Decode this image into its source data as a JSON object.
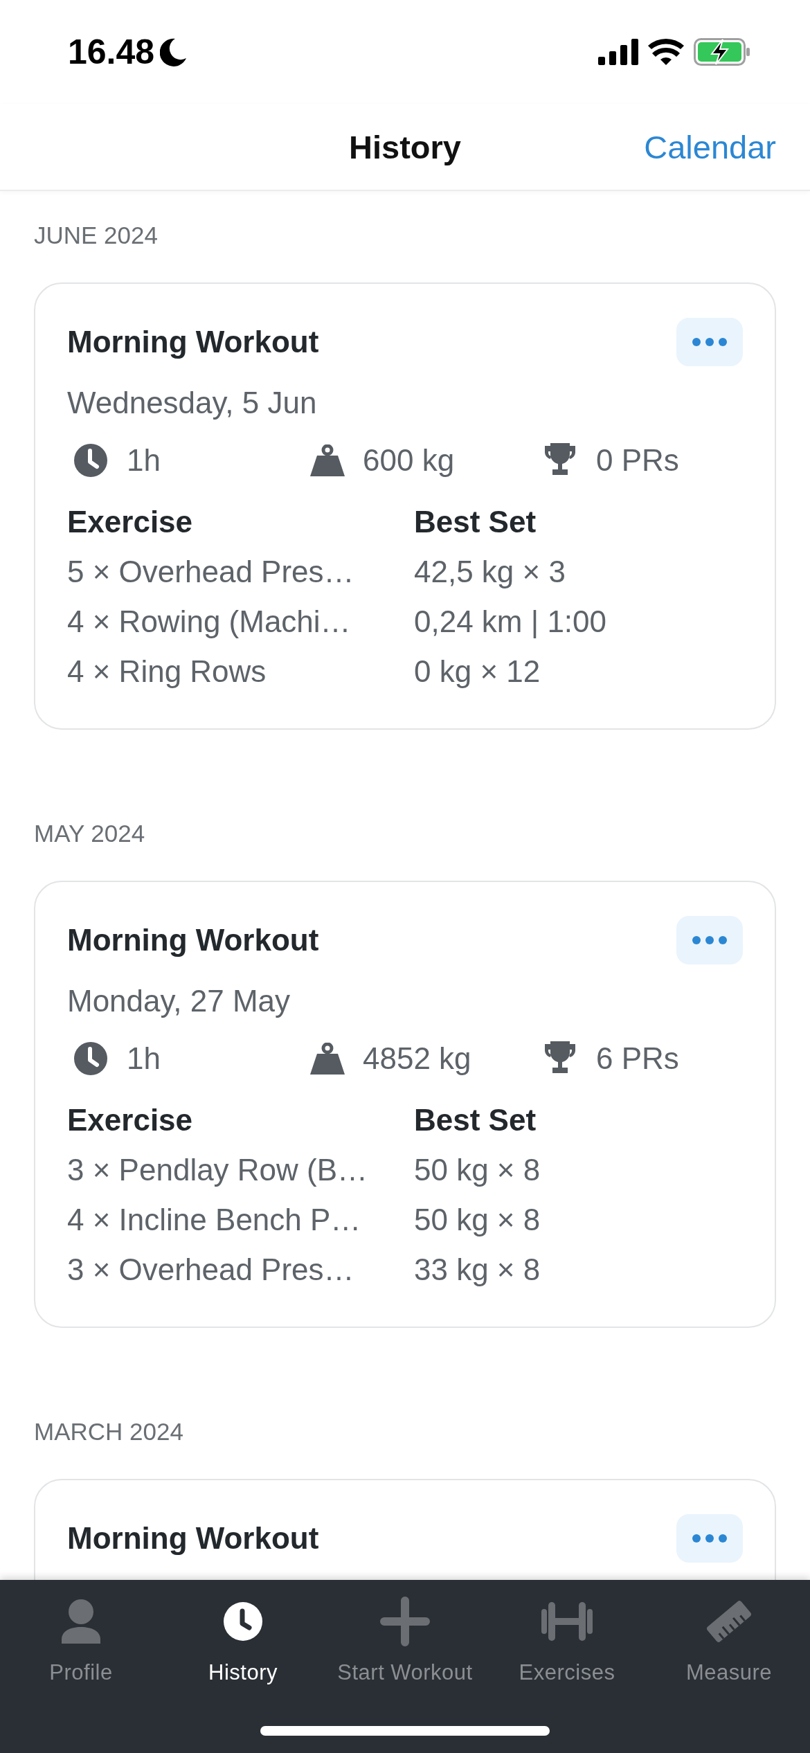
{
  "status_bar": {
    "time": "16.48"
  },
  "header": {
    "title": "History",
    "action": "Calendar"
  },
  "sections": [
    {
      "label": "JUNE 2024",
      "workouts": [
        {
          "title": "Morning Workout",
          "date": "Wednesday, 5 Jun",
          "stats": [
            {
              "kind": "duration",
              "text": "1h"
            },
            {
              "kind": "volume",
              "text": "600 kg"
            },
            {
              "kind": "prs",
              "text": "0 PRs"
            }
          ],
          "columns": [
            "Exercise",
            "Best Set"
          ],
          "rows": [
            {
              "exercise": "5 × Overhead Pres…",
              "best_set": "42,5 kg × 3"
            },
            {
              "exercise": "4 × Rowing (Machi…",
              "best_set": "0,24 km | 1:00"
            },
            {
              "exercise": "4 × Ring Rows",
              "best_set": "0 kg × 12"
            }
          ]
        }
      ]
    },
    {
      "label": "MAY 2024",
      "workouts": [
        {
          "title": "Morning Workout",
          "date": "Monday, 27 May",
          "stats": [
            {
              "kind": "duration",
              "text": "1h"
            },
            {
              "kind": "volume",
              "text": "4852 kg"
            },
            {
              "kind": "prs",
              "text": "6 PRs"
            }
          ],
          "columns": [
            "Exercise",
            "Best Set"
          ],
          "rows": [
            {
              "exercise": "3 × Pendlay Row (B…",
              "best_set": "50 kg × 8"
            },
            {
              "exercise": "4 × Incline Bench P…",
              "best_set": "50 kg × 8"
            },
            {
              "exercise": "3 × Overhead Pres…",
              "best_set": "33 kg × 8"
            }
          ]
        }
      ]
    },
    {
      "label": "MARCH 2024",
      "workouts": [
        {
          "title": "Morning Workout"
        }
      ]
    }
  ],
  "tabs": [
    {
      "kind": "profile",
      "label": "Profile",
      "selected": false
    },
    {
      "kind": "history",
      "label": "History",
      "selected": true
    },
    {
      "kind": "start",
      "label": "Start Workout",
      "selected": false
    },
    {
      "kind": "exercises",
      "label": "Exercises",
      "selected": false
    },
    {
      "kind": "measure",
      "label": "Measure",
      "selected": false
    }
  ]
}
